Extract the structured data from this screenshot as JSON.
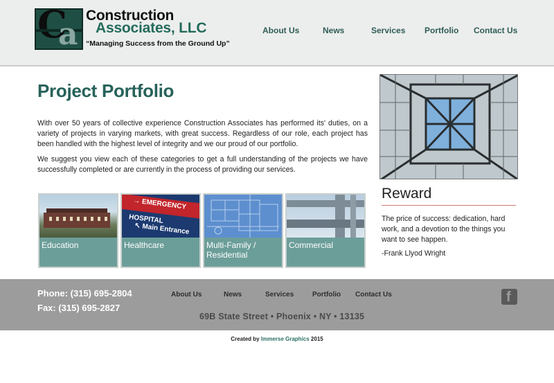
{
  "brand": {
    "name_line1": "Construction",
    "name_line2": "Associates, LLC",
    "tagline": "“Managing Success from the Ground Up”",
    "logo_letters": "CA",
    "colors": {
      "brand_green": "#246b5c",
      "tile_teal": "#6c9e99",
      "footer_gray": "#9c9c9c"
    }
  },
  "nav": [
    {
      "label": "About Us"
    },
    {
      "label": "News"
    },
    {
      "label": "Services"
    },
    {
      "label": "Portfolio"
    },
    {
      "label": "Contact Us"
    }
  ],
  "main": {
    "title": "Project Portfolio",
    "paragraph1": "With over 50 years of collective experience Construction Associates has performed its' duties, on a variety of projects in varying markets, with great success. Regardless of our role, each project has been handled with the highest level of integrity and we our proud of our portfolio.",
    "paragraph2": "We suggest you view each of these categories to get a full understanding of the projects we have successfully completed or are currently in the process of providing our services."
  },
  "tiles": [
    {
      "label": "Education",
      "image": "campus-building-photo"
    },
    {
      "label": "Healthcare",
      "image": "hospital-emergency-sign-photo",
      "sign_lines": [
        "→ EMERGENCY",
        "HOSPITAL",
        "↖ Main Entrance"
      ]
    },
    {
      "label": "Multi-Family / Residential",
      "image": "blueprint-photo"
    },
    {
      "label": "Commercial",
      "image": "steel-beam-photo"
    }
  ],
  "sidebar": {
    "image": "glass-skylight-photo",
    "reward_title": "Reward",
    "reward_quote": "The price of success: dedication, hard work, and a devotion to the things you want to see happen.",
    "reward_author": "-Frank Llyod Wright"
  },
  "footer": {
    "phone": "Phone: (315) 695-2804",
    "fax": "Fax: (315) 695-2827",
    "nav": [
      {
        "label": "About Us"
      },
      {
        "label": "News"
      },
      {
        "label": "Services"
      },
      {
        "label": "Portfolio"
      },
      {
        "label": "Contact Us"
      }
    ],
    "address": "69B State Street • Phoenix • NY • 13135",
    "social_icon": "facebook-icon",
    "social_glyph": "f"
  },
  "credit": {
    "prefix": "Created by",
    "link": "Immerse Graphics",
    "year": "2015"
  }
}
